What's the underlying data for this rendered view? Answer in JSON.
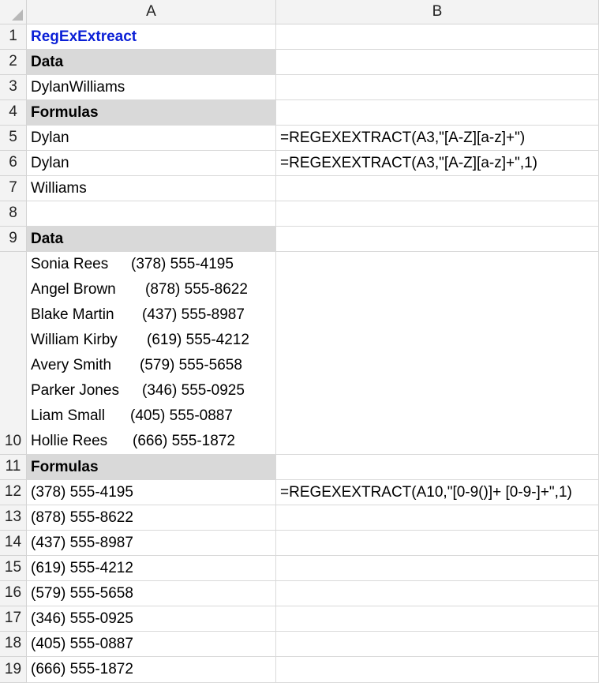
{
  "columns": [
    "A",
    "B"
  ],
  "rows": {
    "r1": {
      "num": "1",
      "a": "RegExExtreact",
      "b": ""
    },
    "r2": {
      "num": "2",
      "a": "Data",
      "b": ""
    },
    "r3": {
      "num": "3",
      "a": "DylanWilliams",
      "b": ""
    },
    "r4": {
      "num": "4",
      "a": "Formulas",
      "b": ""
    },
    "r5": {
      "num": "5",
      "a": "Dylan",
      "b": "=REGEXEXTRACT(A3,\"[A-Z][a-z]+\")"
    },
    "r6": {
      "num": "6",
      "a": "Dylan",
      "b": "=REGEXEXTRACT(A3,\"[A-Z][a-z]+\",1)"
    },
    "r7": {
      "num": "7",
      "a": "Williams",
      "b": ""
    },
    "r8": {
      "num": "8",
      "a": "",
      "b": ""
    },
    "r9": {
      "num": "9",
      "a": "Data",
      "b": ""
    },
    "r10": {
      "num": "10",
      "b": "",
      "lines": [
        {
          "name": "Sonia Rees",
          "phone": "(378) 555-4195"
        },
        {
          "name": "Angel Brown",
          "phone": "(878) 555-8622"
        },
        {
          "name": "Blake Martin",
          "phone": "(437) 555-8987"
        },
        {
          "name": "William Kirby",
          "phone": "(619) 555-4212"
        },
        {
          "name": "Avery Smith",
          "phone": "(579) 555-5658"
        },
        {
          "name": "Parker Jones",
          "phone": "(346) 555-0925"
        },
        {
          "name": "Liam Small",
          "phone": "(405) 555-0887"
        },
        {
          "name": "Hollie Rees",
          "phone": "(666) 555-1872"
        }
      ]
    },
    "r11": {
      "num": "11",
      "a": "Formulas",
      "b": ""
    },
    "r12": {
      "num": "12",
      "a": "(378) 555-4195",
      "b": "=REGEXEXTRACT(A10,\"[0-9()]+ [0-9-]+\",1)"
    },
    "r13": {
      "num": "13",
      "a": "(878) 555-8622",
      "b": ""
    },
    "r14": {
      "num": "14",
      "a": "(437) 555-8987",
      "b": ""
    },
    "r15": {
      "num": "15",
      "a": "(619) 555-4212",
      "b": ""
    },
    "r16": {
      "num": "16",
      "a": "(579) 555-5658",
      "b": ""
    },
    "r17": {
      "num": "17",
      "a": "(346) 555-0925",
      "b": ""
    },
    "r18": {
      "num": "18",
      "a": "(405) 555-0887",
      "b": ""
    },
    "r19": {
      "num": "19",
      "a": "(666) 555-1872",
      "b": ""
    }
  }
}
